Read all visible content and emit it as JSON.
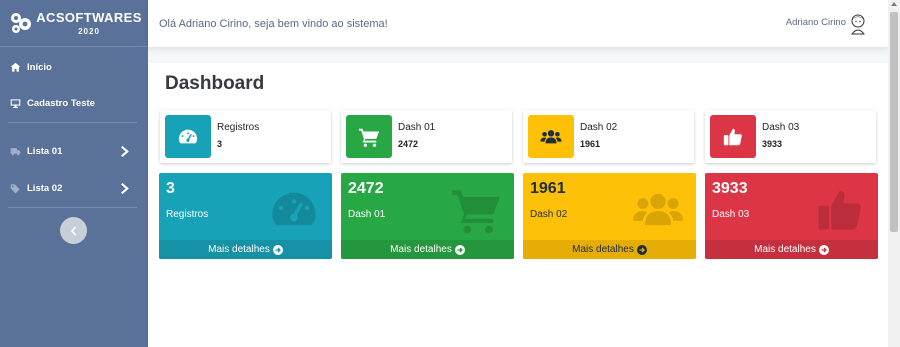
{
  "brand": {
    "title": "ACSOFTWARES",
    "year": "2020"
  },
  "sidebar": {
    "items": [
      {
        "label": "Início",
        "icon": "home-icon"
      },
      {
        "label": "Cadastro Teste",
        "icon": "desktop-icon"
      },
      {
        "label": "Lista 01",
        "icon": "truck-icon"
      },
      {
        "label": "Lista 02",
        "icon": "tags-icon"
      }
    ],
    "toggle_icon": "chevron-left-icon"
  },
  "topbar": {
    "welcome": "Olá Adriano Cirino, seja bem vindo ao sistema!",
    "user_name": "Adriano Cirino"
  },
  "page": {
    "title": "Dashboard"
  },
  "info_boxes": [
    {
      "label": "Registros",
      "value": "3",
      "color": "#17a2b8",
      "icon": "tachometer-icon"
    },
    {
      "label": "Dash 01",
      "value": "2472",
      "color": "#28a745",
      "icon": "cart-icon"
    },
    {
      "label": "Dash 02",
      "value": "1961",
      "color": "#ffc107",
      "icon": "users-icon"
    },
    {
      "label": "Dash 03",
      "value": "3933",
      "color": "#dc3545",
      "icon": "thumbs-up-icon"
    }
  ],
  "small_boxes": [
    {
      "value": "3",
      "label": "Registros",
      "footer": "Mais detalhes",
      "color": "#17a2b8",
      "icon": "tachometer-icon"
    },
    {
      "value": "2472",
      "label": "Dash 01",
      "footer": "Mais detalhes",
      "color": "#28a745",
      "icon": "cart-icon"
    },
    {
      "value": "1961",
      "label": "Dash 02",
      "footer": "Mais detalhes",
      "color": "#ffc107",
      "icon": "users-icon"
    },
    {
      "value": "3933",
      "label": "Dash 03",
      "footer": "Mais detalhes",
      "color": "#dc3545",
      "icon": "thumbs-up-icon"
    }
  ]
}
